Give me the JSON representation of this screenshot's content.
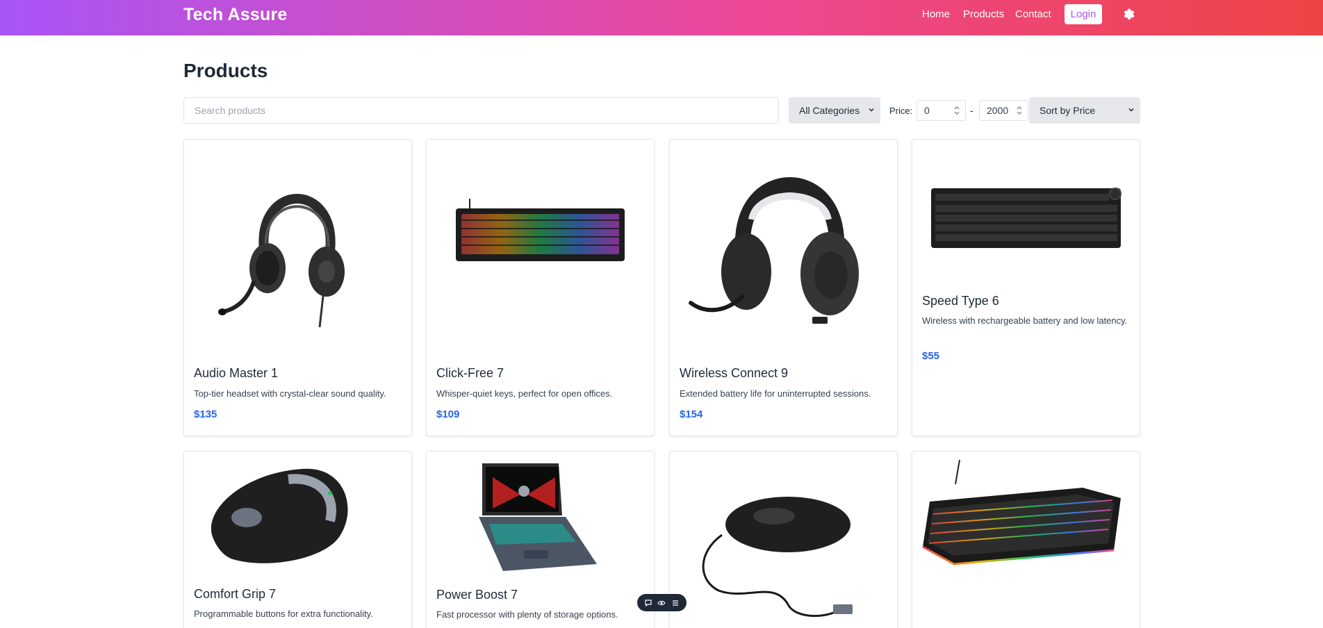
{
  "header": {
    "brand": "Tech Assure",
    "nav": {
      "home": "Home",
      "products": "Products",
      "contact": "Contact"
    },
    "login_label": "Login",
    "settings_icon": "gear-icon"
  },
  "main": {
    "title": "Products",
    "filters": {
      "search_placeholder": "Search products",
      "category": "All Categories",
      "price_label": "Price:",
      "price_min": "0",
      "price_separator": "-",
      "price_max": "2000",
      "sort": "Sort by Price"
    },
    "products": [
      {
        "name": "Audio Master 1",
        "description": "Top-tier headset with crystal-clear sound quality.",
        "price": "$135",
        "image": "headset-icon"
      },
      {
        "name": "Click-Free 7",
        "description": "Whisper-quiet keys, perfect for open offices.",
        "price": "$109",
        "image": "rgb-keyboard-icon"
      },
      {
        "name": "Wireless Connect 9",
        "description": "Extended battery life for uninterrupted sessions.",
        "price": "$154",
        "image": "gaming-headset-icon"
      },
      {
        "name": "Speed Type 6",
        "description": "Wireless with rechargeable battery and low latency.",
        "price": "$55",
        "image": "keyboard-icon"
      },
      {
        "name": "Comfort Grip 7",
        "description": "Programmable buttons for extra functionality.",
        "price": "",
        "image": "ergonomic-mouse-icon"
      },
      {
        "name": "Power Boost 7",
        "description": "Fast processor with plenty of storage options.",
        "price": "",
        "image": "laptop-icon"
      },
      {
        "name": "",
        "description": "",
        "price": "",
        "image": "wired-mouse-icon"
      },
      {
        "name": "",
        "description": "",
        "price": "",
        "image": "compact-keyboard-icon"
      }
    ]
  },
  "floating_toolbar": {
    "icons": [
      "comment-icon",
      "eye-icon",
      "menu-icon"
    ]
  },
  "colors": {
    "gradient_start": "#a855f7",
    "gradient_mid": "#ec4899",
    "gradient_end": "#ef4444",
    "price": "#2563eb"
  }
}
